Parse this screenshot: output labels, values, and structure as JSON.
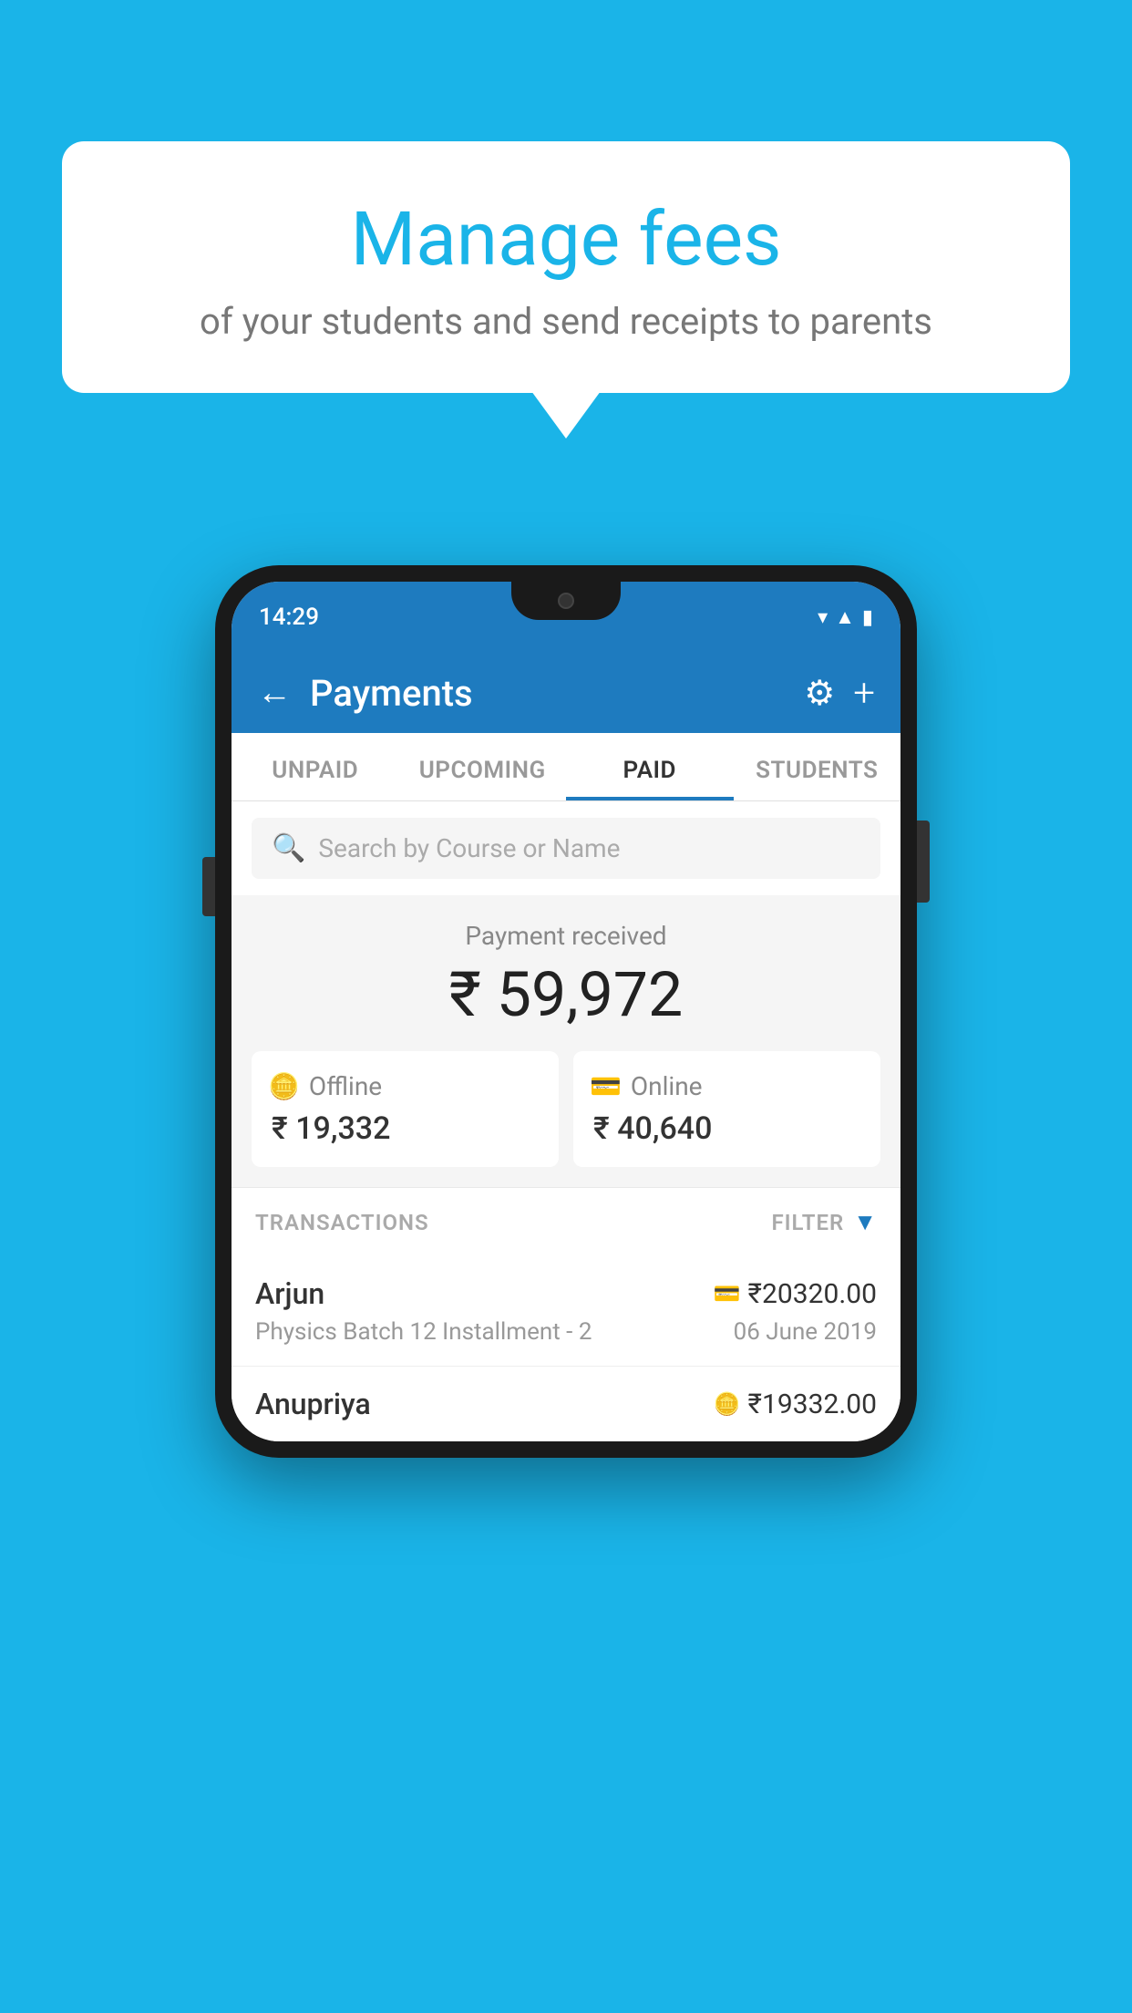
{
  "background_color": "#1ab4e8",
  "bubble": {
    "title": "Manage fees",
    "subtitle": "of your students and send receipts to parents"
  },
  "phone": {
    "status_bar": {
      "time": "14:29",
      "wifi": "▼",
      "signal": "▲",
      "battery": "▮"
    },
    "header": {
      "title": "Payments",
      "back_label": "←",
      "gear_label": "⚙",
      "plus_label": "+"
    },
    "tabs": [
      {
        "label": "UNPAID",
        "active": false
      },
      {
        "label": "UPCOMING",
        "active": false
      },
      {
        "label": "PAID",
        "active": true
      },
      {
        "label": "STUDENTS",
        "active": false
      }
    ],
    "search": {
      "placeholder": "Search by Course or Name"
    },
    "payment_summary": {
      "label": "Payment received",
      "amount": "₹ 59,972",
      "offline": {
        "label": "Offline",
        "amount": "₹ 19,332"
      },
      "online": {
        "label": "Online",
        "amount": "₹ 40,640"
      }
    },
    "transactions_label": "TRANSACTIONS",
    "filter_label": "FILTER",
    "transactions": [
      {
        "name": "Arjun",
        "course": "Physics Batch 12 Installment - 2",
        "amount": "₹20320.00",
        "date": "06 June 2019",
        "icon_type": "card"
      },
      {
        "name": "Anupriya",
        "amount": "₹19332.00",
        "icon_type": "cash",
        "partial": true
      }
    ]
  }
}
